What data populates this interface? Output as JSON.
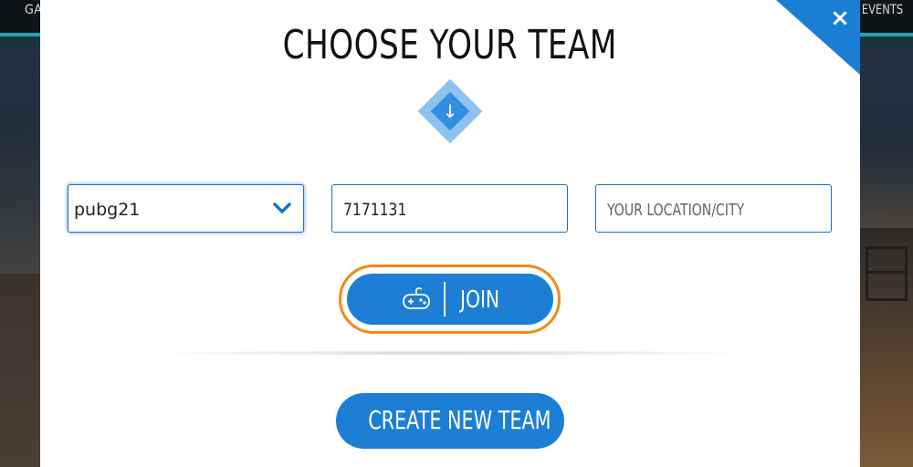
{
  "background": {
    "nav_left": "GA",
    "nav_right": "EVENTS"
  },
  "modal": {
    "title": "CHOOSE YOUR TEAM",
    "close_icon": "×",
    "arrow_icon": "↓",
    "team_select": {
      "value": "pubg21"
    },
    "team_code": {
      "value": "7171131"
    },
    "location": {
      "placeholder": "YOUR LOCATION/CITY"
    },
    "join_label": "JOIN",
    "create_label": "CREATE NEW TEAM"
  },
  "colors": {
    "accent_blue": "#1d7ed6",
    "highlight_orange": "#f08a1a",
    "nav_teal": "#1aa7b8"
  },
  "icons": [
    "close-icon",
    "down-arrow-icon",
    "chevron-down-icon",
    "gamepad-icon"
  ]
}
